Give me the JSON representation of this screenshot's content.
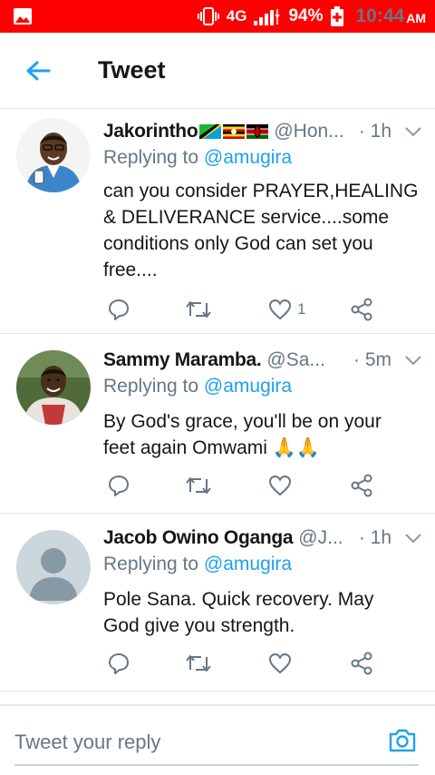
{
  "status_bar": {
    "network": "4G",
    "battery": "94%",
    "time": "10:44",
    "ampm": "AM",
    "background": "#ff0000"
  },
  "header": {
    "title": "Tweet",
    "back_icon": "arrow-left-icon",
    "accent": "#1da1f2"
  },
  "tweets": [
    {
      "name": "Jakorintho",
      "name_flags": [
        "tanzania-flag",
        "uganda-flag",
        "kenya-flag"
      ],
      "handle": "@Hon...",
      "time": "· 1h",
      "replying_prefix": "Replying to ",
      "replying_to": "@amugira",
      "text": "can you consider PRAYER,HEALING & DELIVERANCE service....some conditions only God can set you free....",
      "like_count": "1"
    },
    {
      "name": "Sammy Maramba.",
      "handle": "@Sa...",
      "time": "· 5m",
      "replying_prefix": "Replying to ",
      "replying_to": "@amugira",
      "text": "By God's grace, you'll be on your feet again Omwami 🙏🙏",
      "like_count": ""
    },
    {
      "name": "Jacob Owino Oganga",
      "handle": "@J...",
      "time": "· 1h",
      "replying_prefix": "Replying to ",
      "replying_to": "@amugira",
      "text": "Pole Sana. Quick recovery. May God give you strength.",
      "like_count": ""
    }
  ],
  "composer": {
    "placeholder": "Tweet your reply",
    "camera_icon": "camera-icon"
  }
}
